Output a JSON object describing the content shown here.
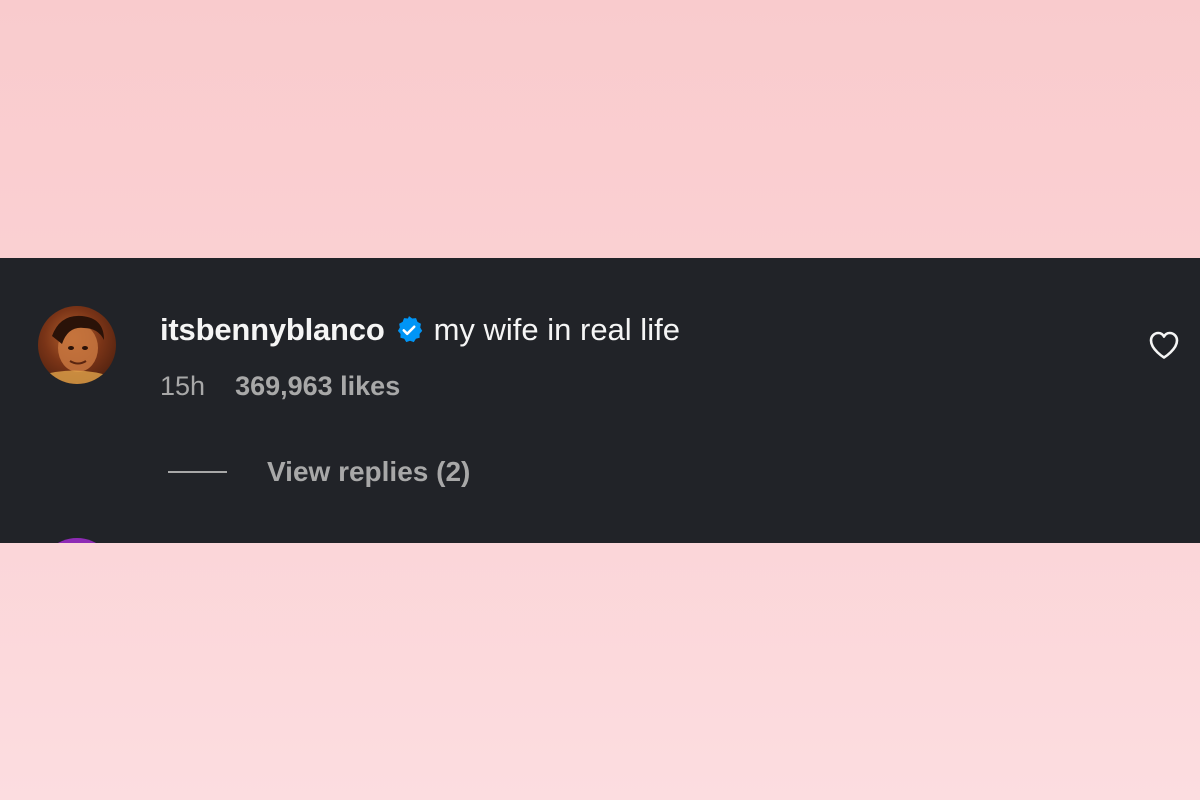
{
  "comment": {
    "username": "itsbennyblanco",
    "text": "my wife in real life",
    "time": "15h",
    "likes": "369,963 likes",
    "view_replies": "View replies (2)",
    "verified_icon": "verified-badge-icon",
    "like_icon": "heart-outline-icon"
  },
  "colors": {
    "panel_background": "#212328",
    "verified_blue": "#0095f6",
    "secondary_text": "#a8a8a8",
    "primary_text": "#f5f5f5",
    "page_background": "#f9cbcd"
  }
}
